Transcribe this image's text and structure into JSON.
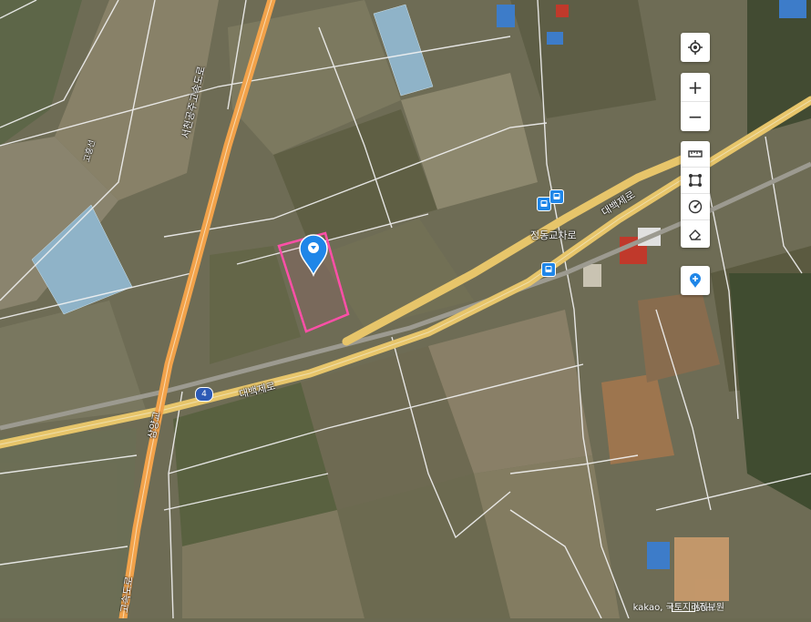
{
  "map": {
    "labels": {
      "expressway_vertical": "서천공주고속도로",
      "expressway_bottom": "고속도로",
      "daebaek_road_1": "대백제로",
      "daebaek_road_2": "대백제로",
      "interchange": "정동교차로",
      "bridge": "삼양교",
      "railway": "고흥선"
    },
    "route_number": "4",
    "marker": {
      "color": "#1f86e8",
      "parcel_outline_color": "#ff4fa8"
    }
  },
  "controls": {
    "location_icon": "crosshair-icon",
    "zoom_in": "+",
    "zoom_out": "−",
    "tools": [
      "ruler-icon",
      "area-icon",
      "radius-icon",
      "eraser-icon"
    ],
    "add_marker_icon": "marker-plus-icon"
  },
  "footer": {
    "attribution": "kakao, 국토지리정보원",
    "scale_label": "50m"
  },
  "colors": {
    "expressway": "#f2a24a",
    "main_road": "#e5c06a",
    "minor_road": "#ffffff",
    "accent": "#1f86e8"
  }
}
